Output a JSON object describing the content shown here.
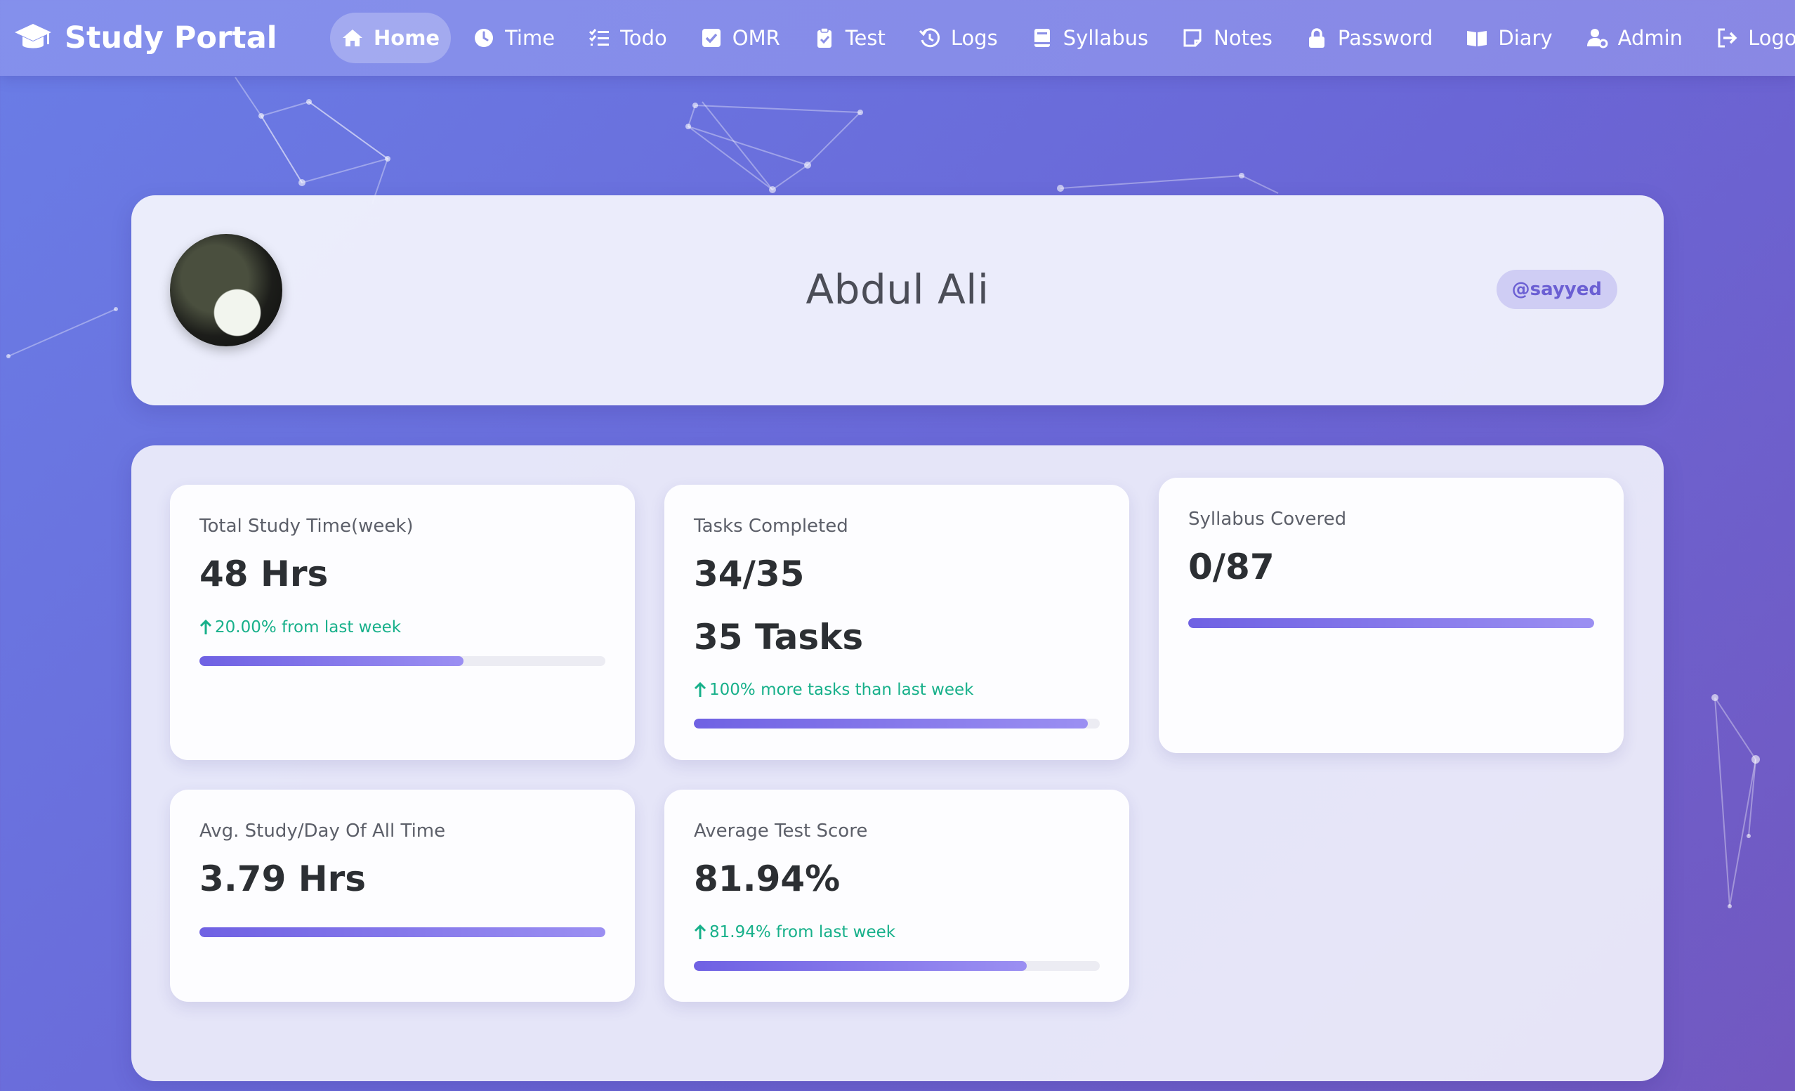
{
  "app": {
    "brand": "Study Portal",
    "brand_icon": "graduation-cap-icon"
  },
  "nav": [
    {
      "label": "Home",
      "icon": "home-icon",
      "active": true
    },
    {
      "label": "Time",
      "icon": "clock-icon"
    },
    {
      "label": "Todo",
      "icon": "list-check-icon"
    },
    {
      "label": "OMR",
      "icon": "check-square-icon"
    },
    {
      "label": "Test",
      "icon": "clipboard-check-icon"
    },
    {
      "label": "Logs",
      "icon": "history-icon"
    },
    {
      "label": "Syllabus",
      "icon": "book-icon"
    },
    {
      "label": "Notes",
      "icon": "note-icon"
    },
    {
      "label": "Password",
      "icon": "lock-icon"
    },
    {
      "label": "Diary",
      "icon": "open-book-icon"
    },
    {
      "label": "Admin",
      "icon": "user-gear-icon"
    },
    {
      "label": "Logout",
      "icon": "logout-icon"
    }
  ],
  "profile": {
    "name": "Abdul Ali",
    "username": "@sayyed"
  },
  "stats": {
    "study_time": {
      "label": "Total Study Time(week)",
      "value": "48 Hrs",
      "change": "20.00% from last week",
      "progress": 0.65
    },
    "tasks": {
      "label": "Tasks Completed",
      "value": "34/35",
      "value2": "35 Tasks",
      "change": "100% more tasks than last week",
      "progress": 0.97
    },
    "syllabus": {
      "label": "Syllabus Covered",
      "value": "0/87",
      "progress": 1.0
    },
    "avg_study": {
      "label": "Avg. Study/Day Of All Time",
      "value": "3.79 Hrs",
      "progress": 1.0
    },
    "test_score": {
      "label": "Average Test Score",
      "value": "81.94%",
      "change": "81.94% from last week",
      "progress": 0.8194
    }
  },
  "colors": {
    "accent": "#6f61e3",
    "positive": "#17b08a",
    "badge_bg": "#cfcdf4",
    "badge_text": "#6b5fd3"
  }
}
